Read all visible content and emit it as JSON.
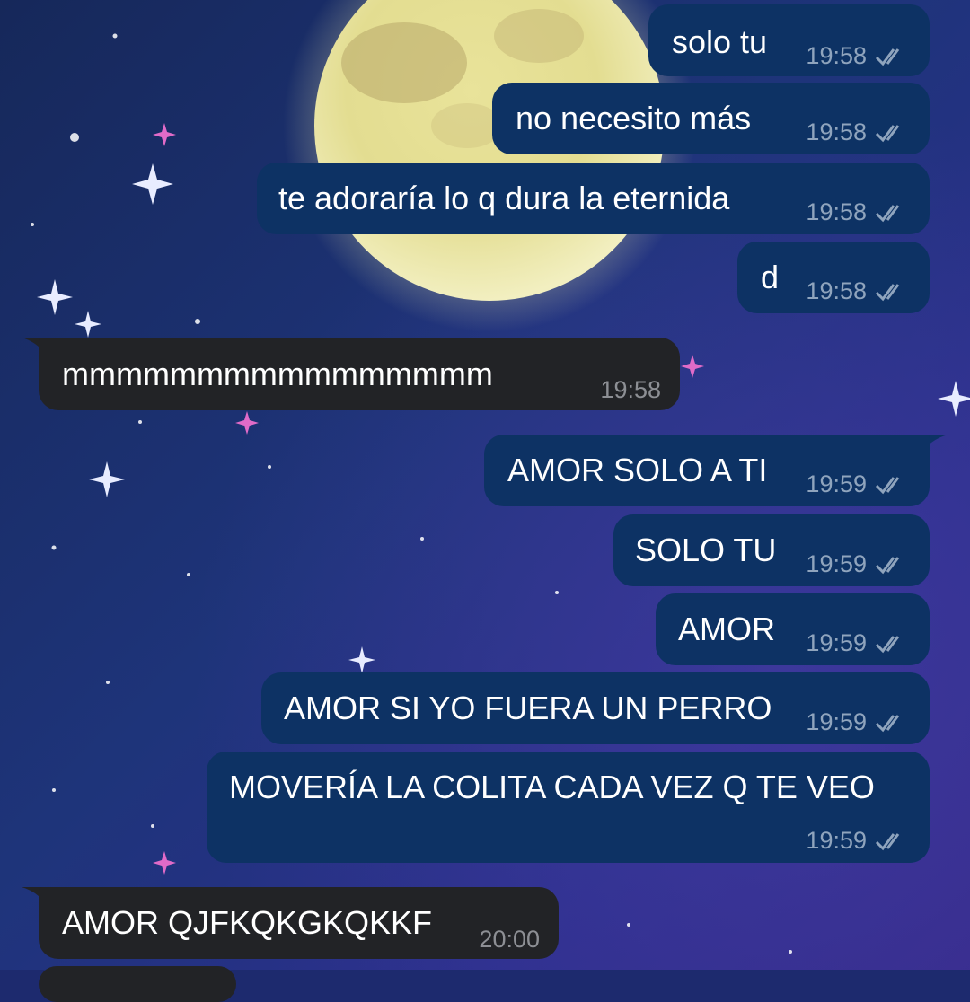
{
  "chat": {
    "messages": [
      {
        "text": "solo tu",
        "time": "19:58",
        "outgoing": true,
        "status_icon": "double-check-icon"
      },
      {
        "text": "no necesito más",
        "time": "19:58",
        "outgoing": true,
        "status_icon": "double-check-icon"
      },
      {
        "text": "te adoraría lo q dura la eternida",
        "time": "19:58",
        "outgoing": true,
        "status_icon": "double-check-icon"
      },
      {
        "text": "d",
        "time": "19:58",
        "outgoing": true,
        "status_icon": "double-check-icon"
      },
      {
        "text": "mmmmmmmmmmmmmmmm",
        "time": "19:58",
        "outgoing": false
      },
      {
        "text": "AMOR SOLO A TI",
        "time": "19:59",
        "outgoing": true,
        "status_icon": "double-check-icon"
      },
      {
        "text": "SOLO TU",
        "time": "19:59",
        "outgoing": true,
        "status_icon": "double-check-icon"
      },
      {
        "text": "AMOR",
        "time": "19:59",
        "outgoing": true,
        "status_icon": "double-check-icon"
      },
      {
        "text": "AMOR SI YO FUERA UN PERRO",
        "time": "19:59",
        "outgoing": true,
        "status_icon": "double-check-icon"
      },
      {
        "text": "MOVERÍA LA COLITA CADA VEZ Q TE VEO",
        "time": "19:59",
        "outgoing": true,
        "status_icon": "double-check-icon"
      },
      {
        "text": "AMOR QJFKQKGKQKKF",
        "time": "20:00",
        "outgoing": false
      }
    ]
  },
  "theme": {
    "outgoing_bubble": "#0d3264",
    "incoming_bubble": "#222326",
    "text_color": "#ffffff",
    "outgoing_meta": "#8fa4bd",
    "incoming_meta": "#8d8f94"
  }
}
